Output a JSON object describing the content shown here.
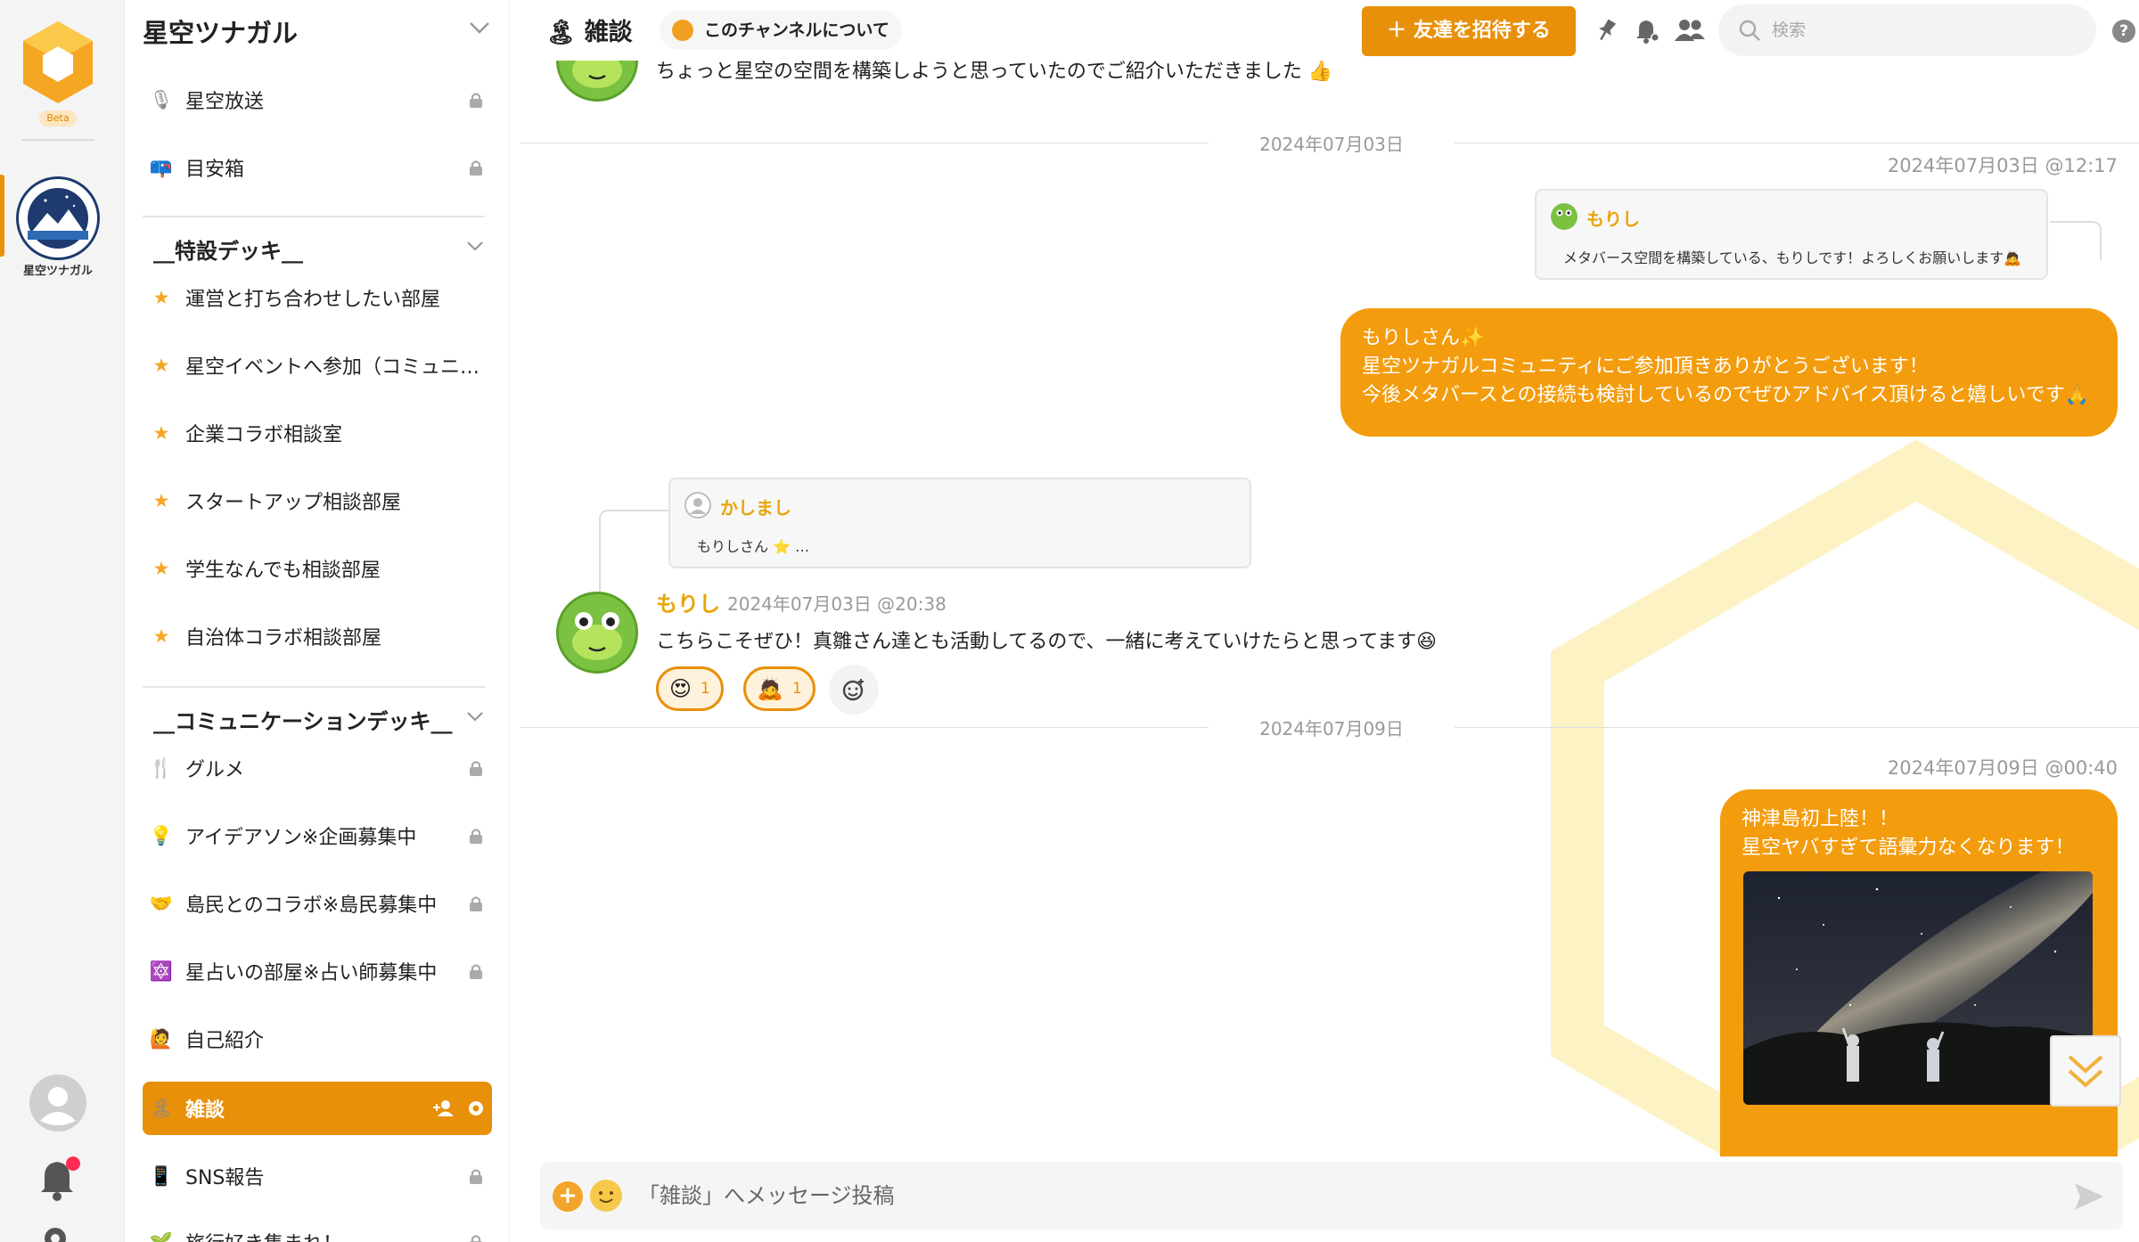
{
  "rail": {
    "beta_label": "Beta",
    "server_name": "星空ツナガル",
    "accent": "#e8900a",
    "notification_badge_color": "#ff2d55"
  },
  "sidebar": {
    "server_title": "星空ツナガル",
    "top_channels": [
      {
        "label": "星空放送",
        "icon": "microphone-icon",
        "locked": true
      },
      {
        "label": "目安箱",
        "icon": "mailbox-icon",
        "locked": true
      }
    ],
    "sections": [
      {
        "title": "__特設デッキ__",
        "channels": [
          {
            "label": "運営と打ち合わせしたい部屋",
            "icon": "star-icon",
            "locked": false
          },
          {
            "label": "星空イベントへ参加（コミュニティ…",
            "icon": "star-icon",
            "locked": false
          },
          {
            "label": "企業コラボ相談室",
            "icon": "star-icon",
            "locked": false
          },
          {
            "label": "スタートアップ相談部屋",
            "icon": "star-icon",
            "locked": false
          },
          {
            "label": "学生なんでも相談部屋",
            "icon": "star-icon",
            "locked": false
          },
          {
            "label": "自治体コラボ相談部屋",
            "icon": "star-icon",
            "locked": false
          }
        ]
      },
      {
        "title": "__コミュニケーションデッキ__",
        "channels": [
          {
            "label": "グルメ",
            "icon": "utensils-icon",
            "locked": true
          },
          {
            "label": "アイデアソン※企画募集中",
            "icon": "lightbulb-icon",
            "locked": true
          },
          {
            "label": "島民とのコラボ※島民募集中",
            "icon": "handshake-icon",
            "locked": true
          },
          {
            "label": "星占いの部屋※占い師募集中",
            "icon": "zodiac-icon",
            "locked": true
          },
          {
            "label": "自己紹介",
            "icon": "person-raising-hand-icon",
            "locked": false
          },
          {
            "label": "雑談",
            "icon": "island-icon",
            "locked": false,
            "active": true
          },
          {
            "label": "SNS報告",
            "icon": "mobile-phone-icon",
            "locked": true
          },
          {
            "label": "旅行好き集まれ！",
            "icon": "plant-icon",
            "locked": true
          }
        ]
      }
    ]
  },
  "header": {
    "channel_name": "雑談",
    "about_label": "このチャンネルについて",
    "invite_label": "＋ 友達を招待する",
    "search_placeholder": "検索",
    "help_label": "?"
  },
  "messages": {
    "top_partial_text": "ちょっと星空の空間を構築しようと思っていたのでご紹介いただきました 👍",
    "date_1": "2024年07月03日",
    "out_1_timestamp": "2024年07月03日 @12:17",
    "out_1_quote_author": "もりし",
    "out_1_quote_text": "メタバース空間を構築している、もりしです！よろしくお願いします🙇",
    "out_1_lines": [
      "もりしさん✨",
      "星空ツナガルコミュニティにご参加頂きありがとうございます！",
      "今後メタバースとの接続も検討しているのでぜひアドバイス頂けると嬉しいです🙏"
    ],
    "in_1_quote_author": "かしまし",
    "in_1_quote_text": "もりしさん ⭐ …",
    "in_1_author": "もりし",
    "in_1_timestamp": "2024年07月03日 @20:38",
    "in_1_text": "こちらこそぜひ！真雛さん達とも活動してるので、一緒に考えていけたらと思ってます😆",
    "in_1_reactions": [
      {
        "emoji": "😍",
        "count": "1"
      },
      {
        "emoji": "🙇",
        "count": "1"
      }
    ],
    "date_2": "2024年07月09日",
    "out_2_timestamp": "2024年07月09日 @00:40",
    "out_2_lines": [
      "神津島初上陸！！",
      "星空ヤバすぎて語彙力なくなります！"
    ]
  },
  "composer": {
    "placeholder": "「雑談」へメッセージ投稿",
    "plus_label": "+"
  }
}
